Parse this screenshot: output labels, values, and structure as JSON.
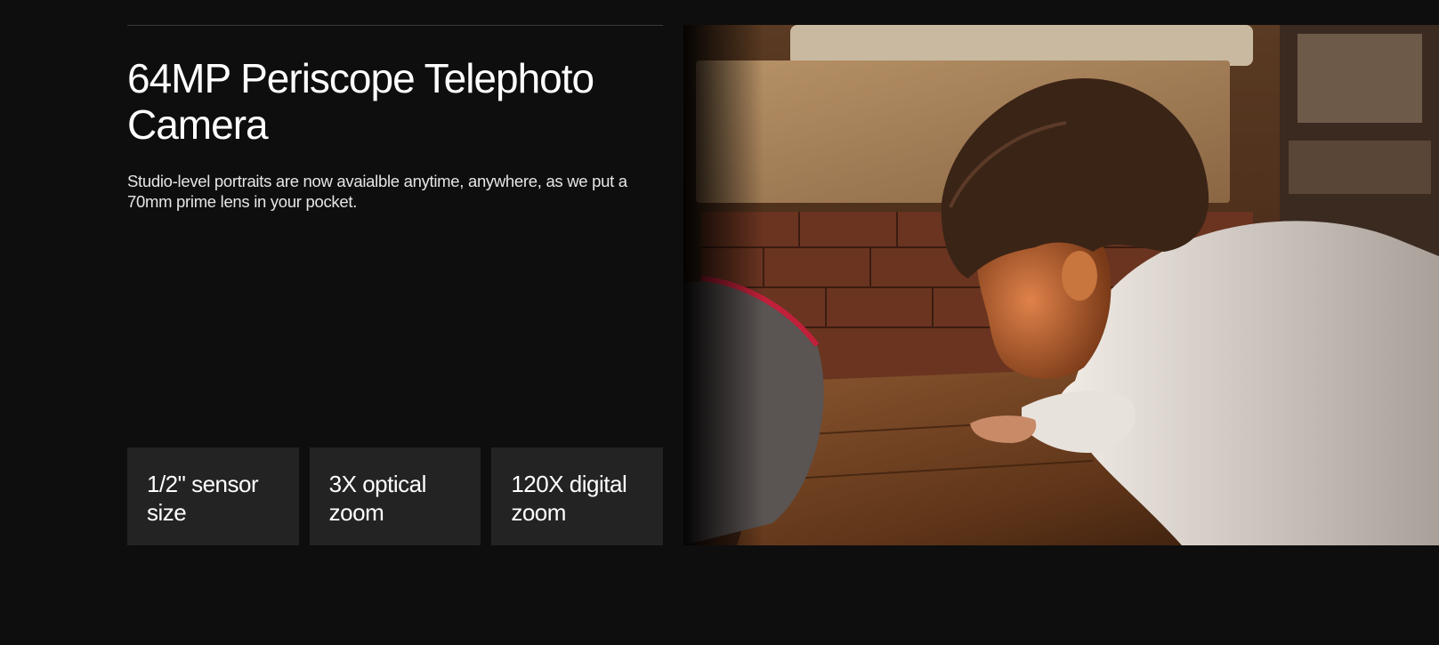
{
  "feature": {
    "title": "64MP Periscope Telephoto Camera",
    "description": "Studio-level portraits are now avaialble anytime, anywhere, as we put a 70mm prime lens in your pocket."
  },
  "specs": [
    {
      "label": "1/2\" sensor size"
    },
    {
      "label": "3X optical zoom"
    },
    {
      "label": "120X digital zoom"
    }
  ],
  "image": {
    "subject": "child-leaning-on-wooden-floor-photo"
  },
  "colors": {
    "background": "#0e0e0e",
    "card": "#232323",
    "text": "#ffffff"
  }
}
